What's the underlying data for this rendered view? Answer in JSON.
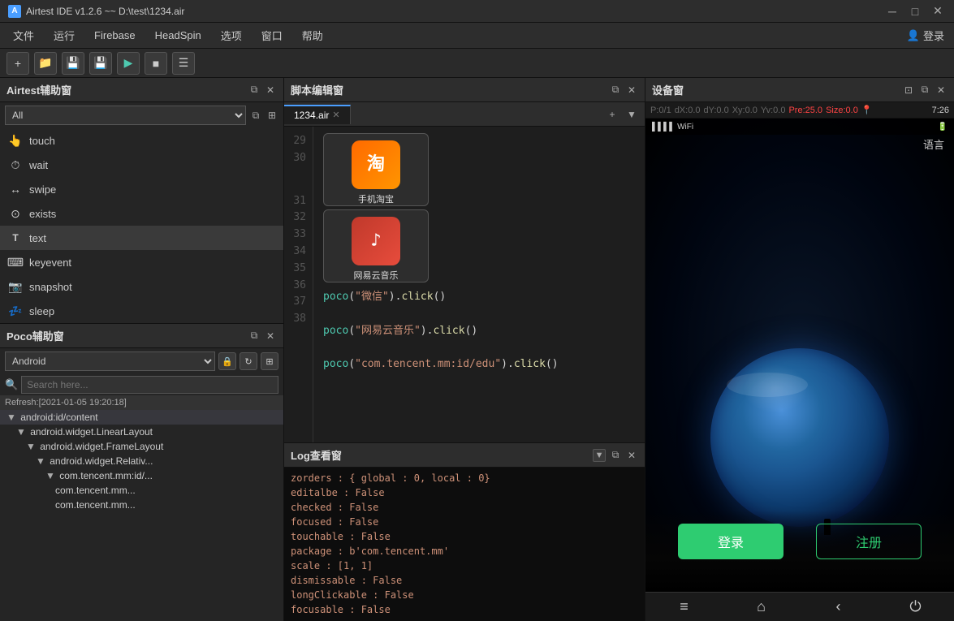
{
  "titleBar": {
    "icon": "A",
    "text": "Airtest IDE v1.2.6 ~~ D:\\test\\1234.air",
    "minimizeLabel": "─",
    "maximizeLabel": "□",
    "closeLabel": "✕"
  },
  "menuBar": {
    "items": [
      {
        "label": "文件"
      },
      {
        "label": "运行"
      },
      {
        "label": "Firebase"
      },
      {
        "label": "HeadSpin"
      },
      {
        "label": "选项"
      },
      {
        "label": "窗口"
      },
      {
        "label": "帮助"
      }
    ],
    "loginLabel": "登录"
  },
  "toolbar": {
    "buttons": [
      "+",
      "📁",
      "💾",
      "💾",
      "▶",
      "■",
      "☰"
    ]
  },
  "airtestPanel": {
    "title": "Airtest辅助窗",
    "filterDefault": "All",
    "apis": [
      {
        "icon": "👆",
        "label": "touch"
      },
      {
        "icon": "⏱",
        "label": "wait"
      },
      {
        "icon": "↔",
        "label": "swipe"
      },
      {
        "icon": "⊙",
        "label": "exists"
      },
      {
        "icon": "T",
        "label": "text"
      },
      {
        "icon": "⌨",
        "label": "keyevent"
      },
      {
        "icon": "📷",
        "label": "snapshot"
      },
      {
        "icon": "💤",
        "label": "sleep"
      }
    ]
  },
  "pocoPanel": {
    "title": "Poco辅助窗",
    "selectDefault": "Android",
    "searchPlaceholder": "Search here...",
    "refreshLabel": "Refresh:[2021-01-05 19:20:18]",
    "tree": [
      {
        "indent": 0,
        "label": "android:id/content",
        "expanded": true
      },
      {
        "indent": 1,
        "label": "android.widget.LinearLayout",
        "expanded": true
      },
      {
        "indent": 2,
        "label": "android.widget.FrameLayout",
        "expanded": true
      },
      {
        "indent": 3,
        "label": "android.widget.Relativ...",
        "expanded": true
      },
      {
        "indent": 4,
        "label": "com.tencent.mm:id/...",
        "expanded": true
      },
      {
        "indent": 5,
        "label": "com.tencent.mm..."
      },
      {
        "indent": 5,
        "label": "com.tencent.mm..."
      }
    ]
  },
  "scriptEditor": {
    "title": "脚本编辑窗",
    "tabs": [
      {
        "label": "1234.air",
        "active": true,
        "closable": true
      }
    ],
    "lineNumbers": [
      29,
      30,
      31,
      32,
      33,
      34,
      35,
      36,
      37,
      38
    ],
    "codeLines": [
      {
        "type": "image",
        "content": "taobao"
      },
      {
        "type": "blank"
      },
      {
        "type": "blank"
      },
      {
        "type": "code",
        "content": "poco(\"微信\").click()"
      },
      {
        "type": "code",
        "content": "poco(\"网易云音乐\").click()"
      },
      {
        "type": "blank"
      },
      {
        "type": "code",
        "content": "poco(\"com.tencent.mm:id/edu\").click()"
      },
      {
        "type": "blank"
      },
      {
        "type": "blank"
      }
    ]
  },
  "logPanel": {
    "title": "Log查看窗",
    "lines": [
      "zorders : { global : 0, local : 0}",
      "editalbe : False",
      "checked : False",
      "focused : False",
      "touchable : False",
      "package : b'com.tencent.mm'",
      "scale : [1, 1]",
      "dismissable : False",
      "longClickable : False",
      "focusable : False"
    ]
  },
  "deviceWindow": {
    "title": "设备窗",
    "stats": {
      "p": "P:0/1",
      "dx": "dX:0.0",
      "dy": "dY:0.0",
      "xy": "Xy:0.0",
      "yv": "Yv:0.0",
      "pre": "Pre:25.0",
      "size": "Size:0.0"
    },
    "timeLabel": "7:26",
    "langLabel": "语言",
    "loginBtnLabel": "登录",
    "registerBtnLabel": "注册",
    "navItems": [
      "≡",
      "⌂",
      "‹",
      "⏻"
    ]
  },
  "colors": {
    "accent": "#4a9eff",
    "green": "#2ecc71",
    "loginBg": "#2ecc71",
    "registerBorder": "#2ecc71",
    "logText": "#ce9178",
    "preHighlight": "#ff0000"
  }
}
